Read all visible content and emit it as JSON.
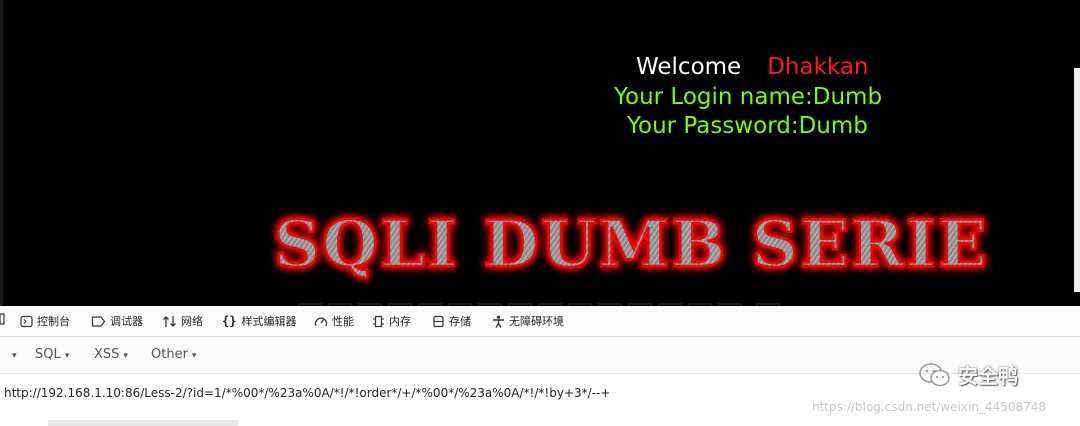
{
  "page": {
    "welcome": "Welcome",
    "user_name": "Dhakkan",
    "login_line": "Your Login name:Dumb",
    "password_line": "Your Password:Dumb",
    "banner_text": "SQLI DUMB SERIE"
  },
  "devtools": {
    "tabs": [
      {
        "label": "控制台",
        "icon": "console-icon"
      },
      {
        "label": "调试器",
        "icon": "debugger-icon"
      },
      {
        "label": "网络",
        "icon": "network-icon"
      },
      {
        "label": "样式编辑器",
        "icon": "style-editor-icon"
      },
      {
        "label": "性能",
        "icon": "performance-icon"
      },
      {
        "label": "内存",
        "icon": "memory-icon"
      },
      {
        "label": "存储",
        "icon": "storage-icon"
      },
      {
        "label": "无障碍环境",
        "icon": "accessibility-icon"
      }
    ]
  },
  "hackbar": {
    "menus": [
      {
        "label": "SQL"
      },
      {
        "label": "XSS"
      },
      {
        "label": "Other"
      }
    ],
    "url_value": "http://192.168.1.10:86/Less-2/?id=1/*%00*/%23a%0A/*!/*!order*/+/*%00*/%23a%0A/*!/*!by+3*/--+"
  },
  "watermark": {
    "name": "安全鸭",
    "url": "https://blog.csdn.net/weixin_44508748"
  },
  "colors": {
    "page_bg": "#000000",
    "welcome": "#ffffff",
    "user_name": "#ff1a1a",
    "info_text": "#7cfc00",
    "banner_glow": "#ff0000"
  }
}
